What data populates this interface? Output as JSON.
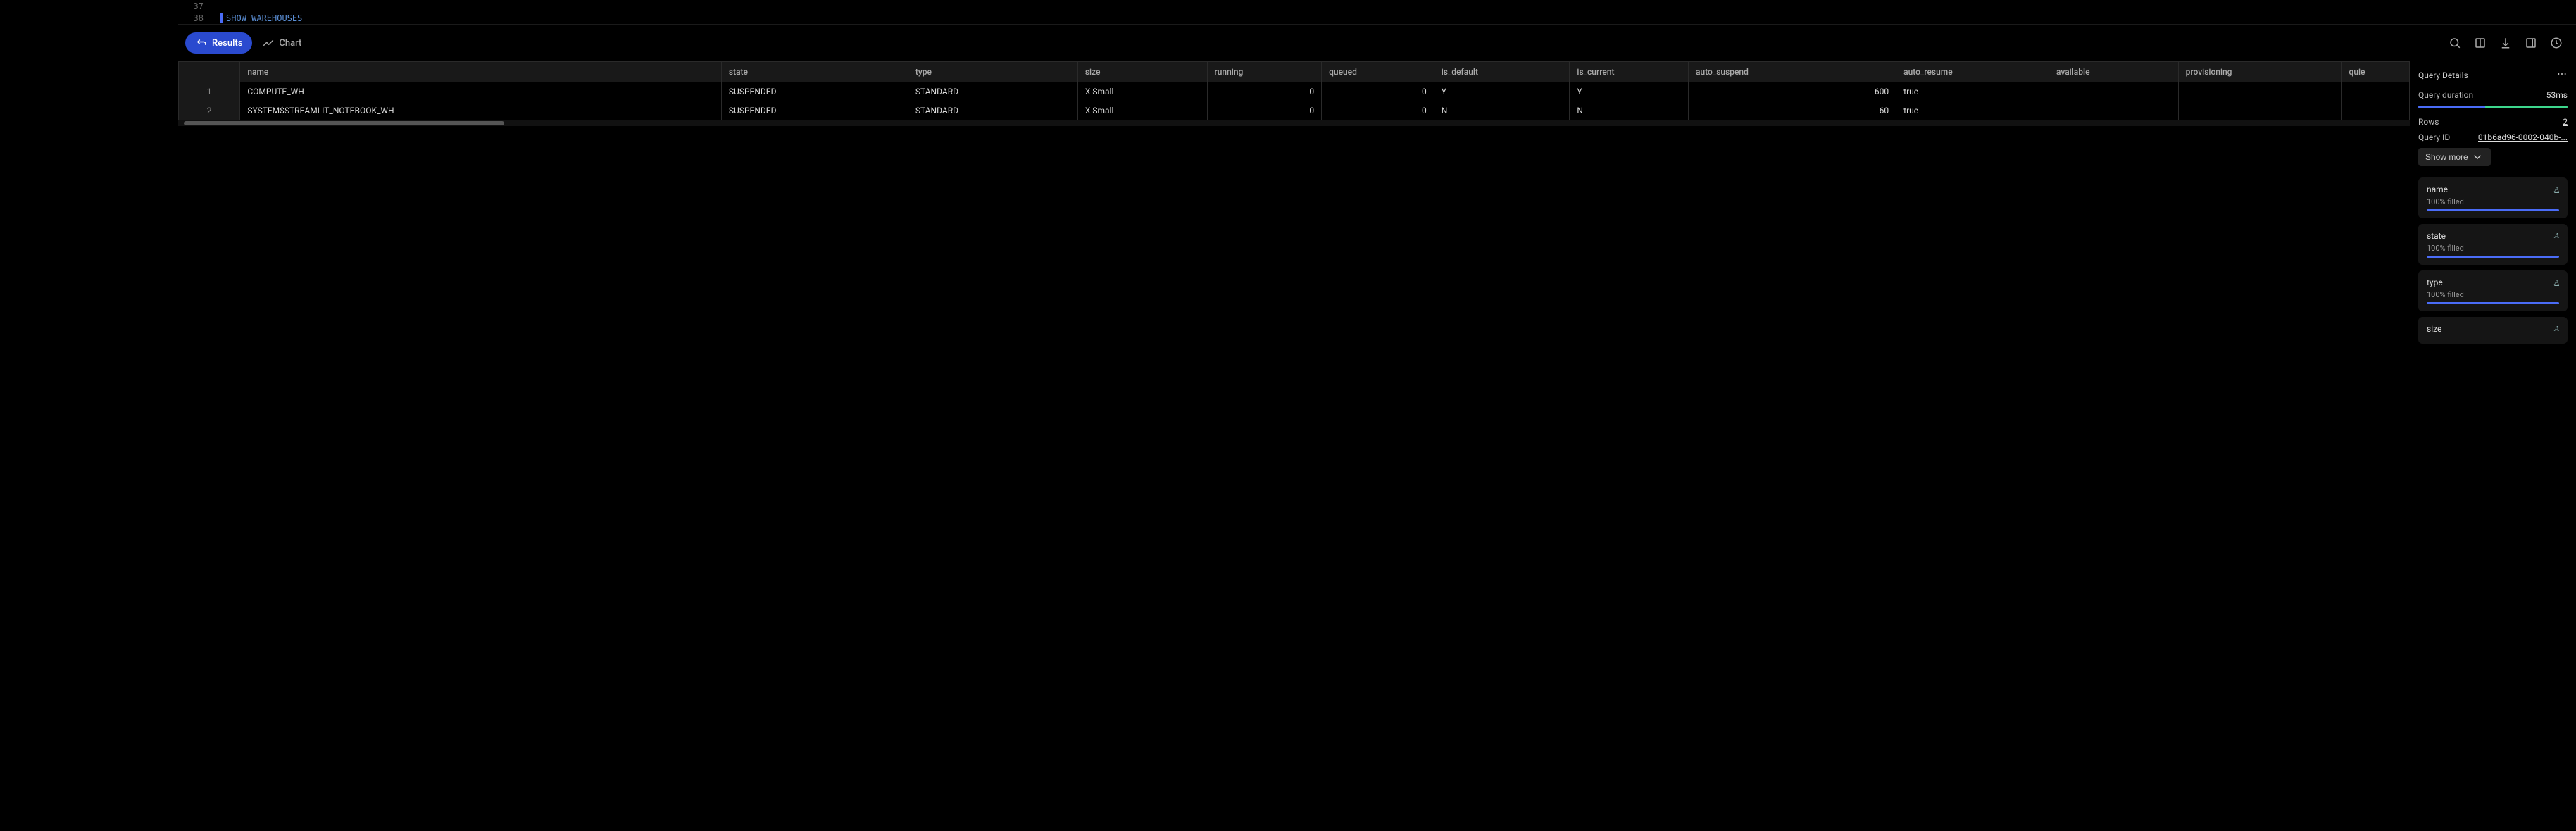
{
  "editor": {
    "lines": [
      {
        "num": "37",
        "content": ""
      },
      {
        "num": "38",
        "content": "SHOW WAREHOUSES"
      }
    ]
  },
  "tabs": {
    "results": "Results",
    "chart": "Chart"
  },
  "table": {
    "headers": [
      "name",
      "state",
      "type",
      "size",
      "running",
      "queued",
      "is_default",
      "is_current",
      "auto_suspend",
      "auto_resume",
      "available",
      "provisioning",
      "quie"
    ],
    "rows": [
      {
        "num": "1",
        "cells": [
          "COMPUTE_WH",
          "SUSPENDED",
          "STANDARD",
          "X-Small",
          "0",
          "0",
          "Y",
          "Y",
          "600",
          "true",
          "",
          "",
          ""
        ]
      },
      {
        "num": "2",
        "cells": [
          "SYSTEM$STREAMLIT_NOTEBOOK_WH",
          "SUSPENDED",
          "STANDARD",
          "X-Small",
          "0",
          "0",
          "N",
          "N",
          "60",
          "true",
          "",
          "",
          ""
        ]
      }
    ]
  },
  "details": {
    "title": "Query Details",
    "duration_label": "Query duration",
    "duration_value": "53ms",
    "rows_label": "Rows",
    "rows_value": "2",
    "query_id_label": "Query ID",
    "query_id_value": "01b6ad96-0002-040b-...",
    "show_more": "Show more",
    "columns": [
      {
        "name": "name",
        "type": "A",
        "fill": "100% filled"
      },
      {
        "name": "state",
        "type": "A",
        "fill": "100% filled"
      },
      {
        "name": "type",
        "type": "A",
        "fill": "100% filled"
      },
      {
        "name": "size",
        "type": "A",
        "fill": ""
      }
    ]
  }
}
